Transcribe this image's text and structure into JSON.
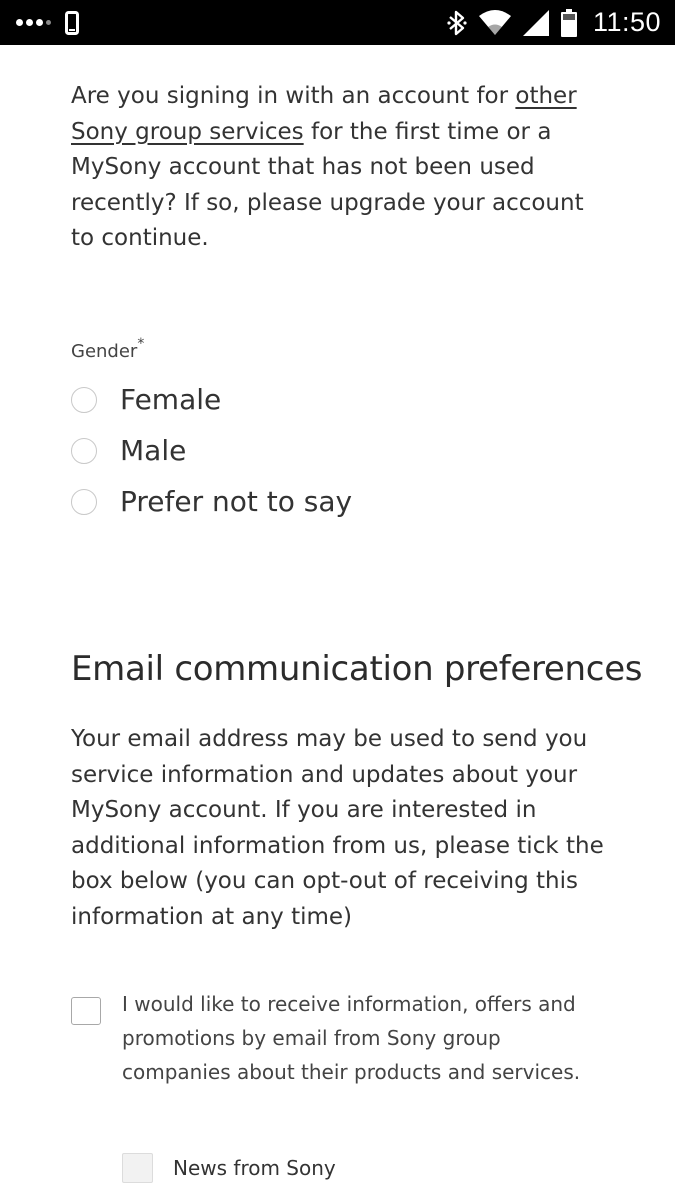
{
  "status_bar": {
    "time": "11:50",
    "icons": [
      "signal-dots-icon",
      "phone-icon",
      "bluetooth-icon",
      "wifi-icon",
      "cell-signal-icon",
      "battery-icon"
    ]
  },
  "intro": {
    "prefix": "Are you signing in with an account for ",
    "link": "other Sony group services",
    "suffix": " for the first time or a MySony account that has not been used recently? If so, please upgrade your account to continue."
  },
  "gender": {
    "label": "Gender",
    "required_mark": "*",
    "options": [
      "Female",
      "Male",
      "Prefer not to say"
    ]
  },
  "email_prefs": {
    "title": "Email communication preferences",
    "description": "Your email address may be used to send you service information and updates about your MySony account. If you are interested in additional information from us, please tick the box below (you can opt-out of receiving this information at any time)",
    "opt_in_label": "I would like to receive information, offers and promotions by email from Sony group companies about their products and services.",
    "sub_options": [
      "News from Sony"
    ]
  },
  "colors": {
    "status_bar_bg": "#000000",
    "text": "#333333",
    "border": "#c9c9c9"
  }
}
